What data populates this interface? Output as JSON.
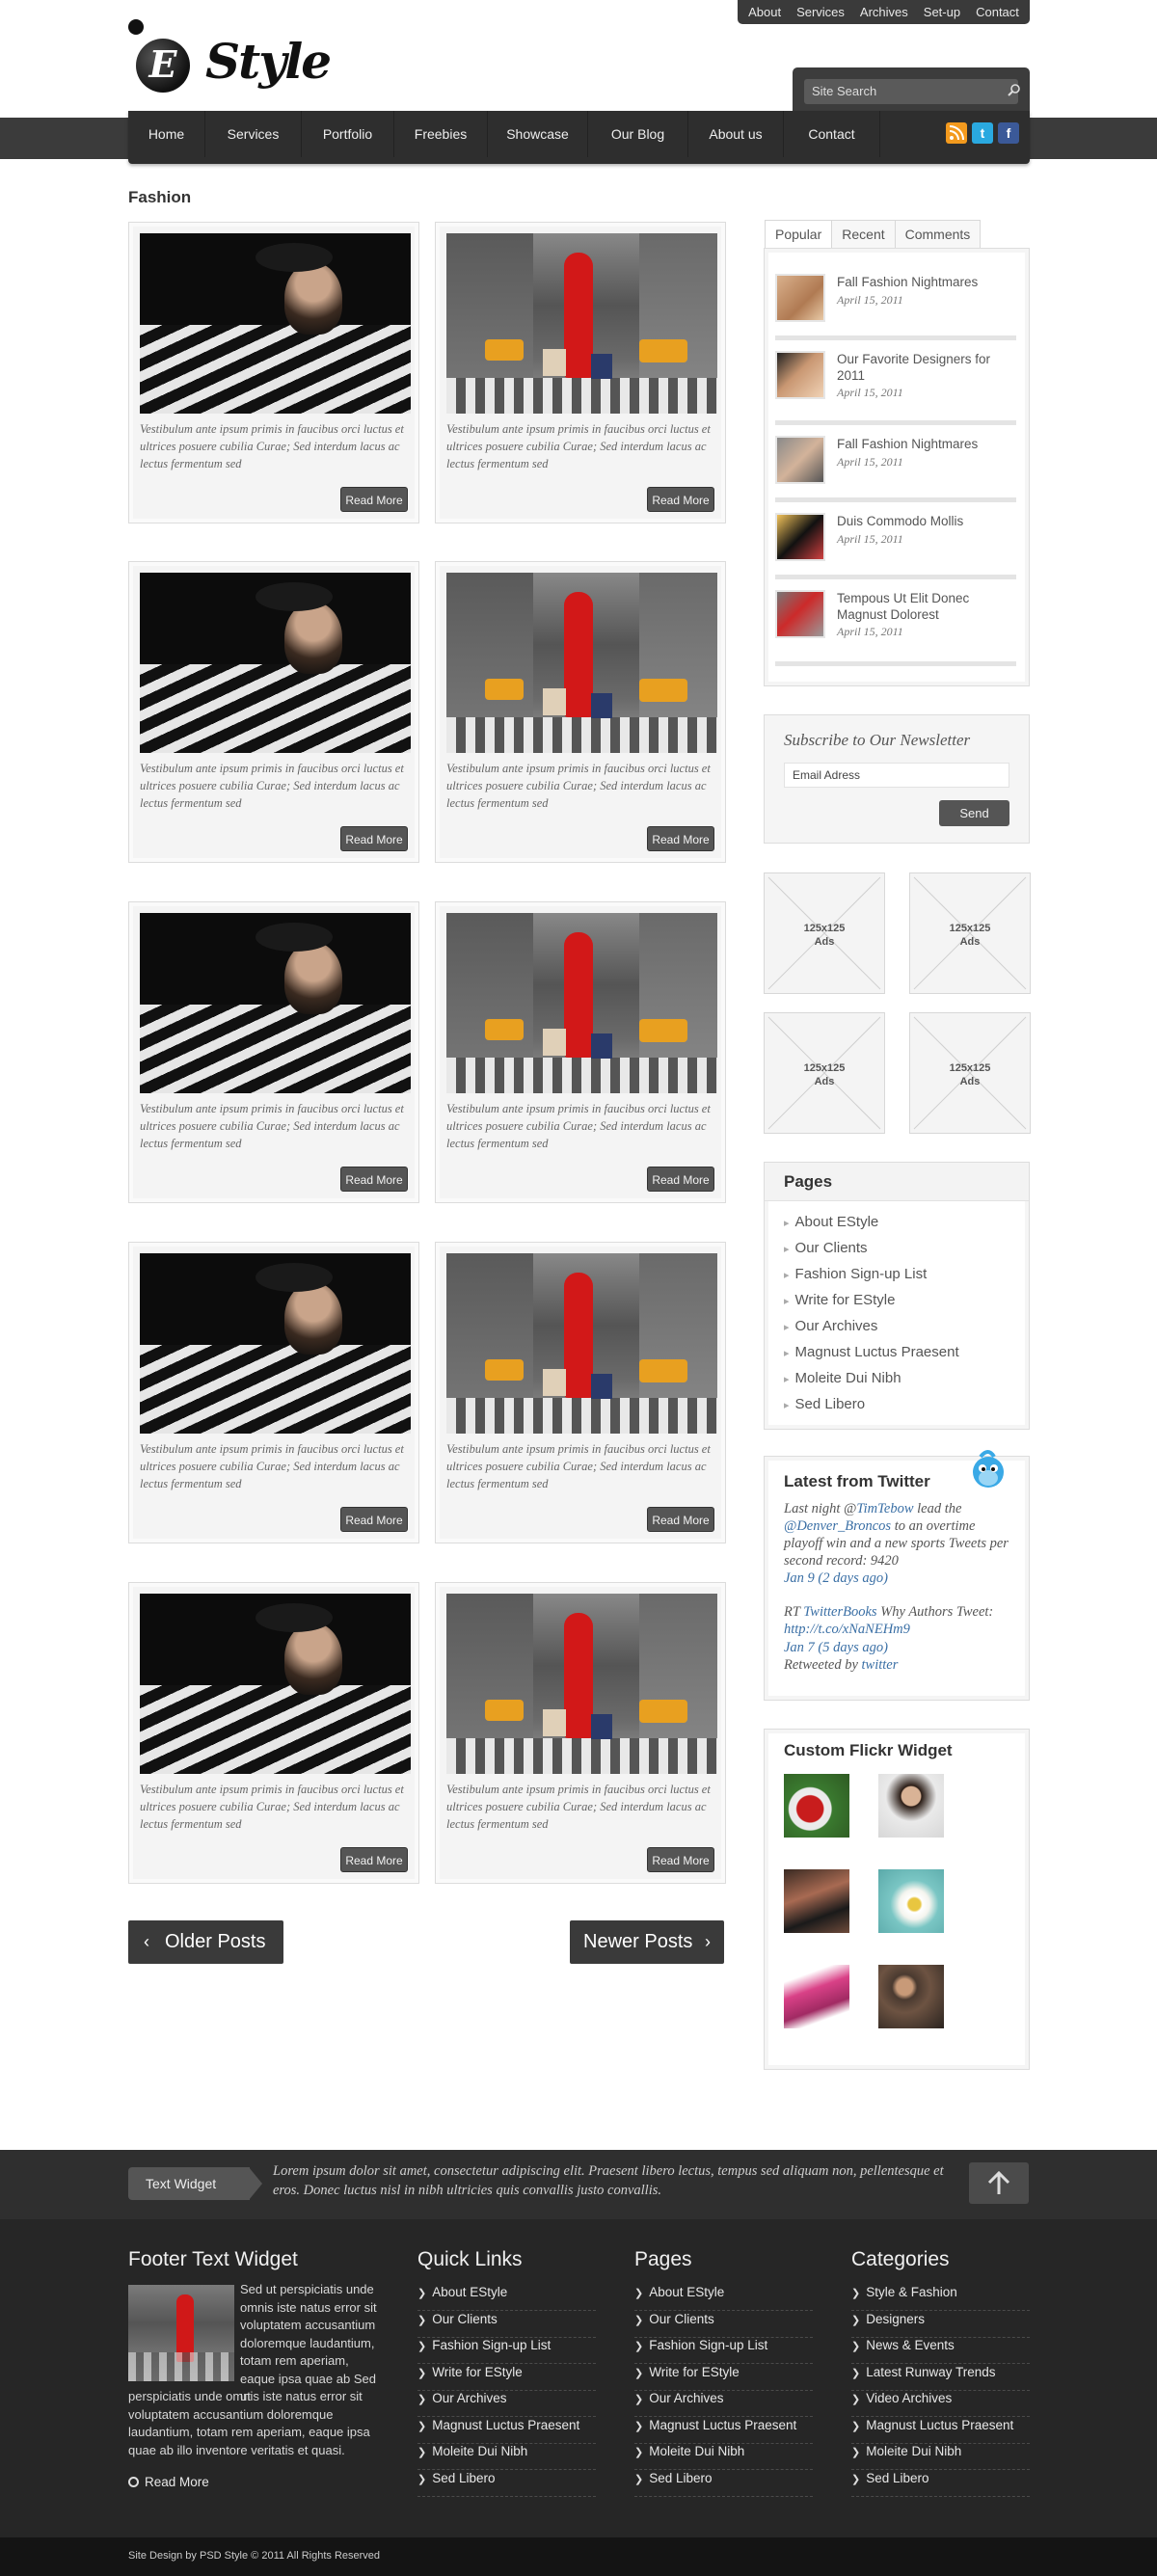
{
  "toplinks": [
    "About",
    "Services",
    "Archives",
    "Set-up",
    "Contact"
  ],
  "logo": {
    "letter": "E",
    "word": "Style"
  },
  "search": {
    "placeholder": "Site Search"
  },
  "nav": [
    "Home",
    "Services",
    "Portfolio",
    "Freebies",
    "Showcase",
    "Our Blog",
    "About us",
    "Contact"
  ],
  "social": [
    "rss-icon",
    "twitter-icon",
    "facebook-icon"
  ],
  "colors": {
    "accent": "#3b3b3b",
    "link": "#3a6fa5",
    "footer": "#262626",
    "rss": "#f39a1e",
    "twitter": "#2aa9e0",
    "facebook": "#3b5998"
  },
  "section": "Fashion",
  "posts": {
    "excerpt": "Vestibulum ante ipsum primis in faucibus orci luctus et ultrices posuere cubilia Curae; Sed interdum lacus ac lectus fermentum sed",
    "read_more": "Read More"
  },
  "pagination": {
    "older": "Older Posts",
    "newer": "Newer Posts"
  },
  "tabs": [
    "Popular",
    "Recent",
    "Comments"
  ],
  "popular": [
    {
      "title": "Fall Fashion Nightmares",
      "date": "April 15, 2011"
    },
    {
      "title": "Our Favorite Designers for 2011",
      "date": "April 15, 2011"
    },
    {
      "title": "Fall Fashion Nightmares",
      "date": "April 15, 2011"
    },
    {
      "title": "Duis Commodo Mollis",
      "date": "April 15, 2011"
    },
    {
      "title": "Tempous Ut Elit Donec Magnust Dolorest",
      "date": "April 15, 2011"
    }
  ],
  "newsletter": {
    "title": "Subscribe to Our Newsletter",
    "placeholder": "Email Adress",
    "button": "Send"
  },
  "ads": {
    "size": "125x125",
    "label": "Ads"
  },
  "pages_widget": {
    "title": "Pages",
    "items": [
      "About EStyle",
      "Our Clients",
      "Fashion Sign-up List",
      "Write for EStyle",
      "Our Archives",
      "Magnust Luctus Praesent",
      "Moleite Dui Nibh",
      "Sed Libero"
    ]
  },
  "twitter": {
    "title": "Latest from Twitter",
    "t1_a": "Last night @",
    "t1_b": "TimTebow",
    "t1_c": " lead the",
    "t1_d": "@Denver_Broncos",
    "t1_e": " to an overtime playoff win and a new sports Tweets per second record: 9420",
    "t1_time": "Jan 9 (2 days ago)",
    "t2_a": "RT ",
    "t2_b": "TwitterBooks",
    "t2_c": " Why Authors Tweet: ",
    "t2_d": "http://t.co/xNaNEHm9",
    "t2_time": "Jan 7 (5 days ago)",
    "retweeted": "Retweeted by ",
    "retweeter": "twitter"
  },
  "flickr": {
    "title": "Custom Flickr Widget"
  },
  "footer_strip": {
    "tag": "Text Widget",
    "text": "Lorem ipsum dolor sit amet, consectetur adipiscing elit. Praesent libero lectus, tempus sed aliquam non, pellentesque et eros. Donec luctus nisl in nibh ultricies quis convallis justo convallis."
  },
  "footer": {
    "text_widget": {
      "title": "Footer Text Widget",
      "p1": "Sed ut perspiciatis unde omnis iste natus error sit voluptatem accusantium doloremque laudantium, totam rem aperiam, eaque ipsa quae ab Sed ut",
      "p2": "perspiciatis unde omnis iste natus error sit voluptatem accusantium doloremque laudantium, totam rem aperiam, eaque ipsa quae ab illo inventore veritatis et quasi.",
      "read_more": "Read More"
    },
    "quick_links": {
      "title": "Quick Links",
      "items": [
        "About EStyle",
        "Our Clients",
        "Fashion Sign-up List",
        "Write for EStyle",
        "Our Archives",
        "Magnust Luctus Praesent",
        "Moleite Dui Nibh",
        "Sed Libero"
      ]
    },
    "pages": {
      "title": "Pages",
      "items": [
        "About EStyle",
        "Our Clients",
        "Fashion Sign-up List",
        "Write for EStyle",
        "Our Archives",
        "Magnust Luctus Praesent",
        "Moleite Dui Nibh",
        "Sed Libero"
      ]
    },
    "categories": {
      "title": "Categories",
      "items": [
        "Style & Fashion",
        "Designers",
        "News & Events",
        "Latest Runway Trends",
        "Video Archives",
        "Magnust Luctus Praesent",
        "Moleite Dui Nibh",
        "Sed Libero"
      ]
    }
  },
  "copyright": "Site Design by PSD Style © 2011 All Rights Reserved"
}
